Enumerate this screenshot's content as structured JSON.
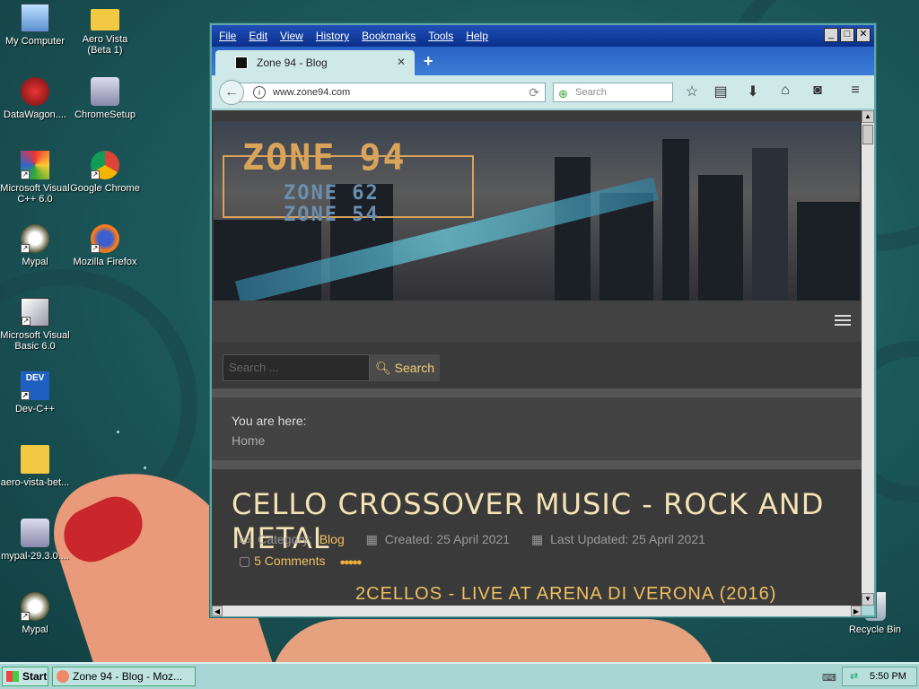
{
  "desktop": {
    "icons": [
      {
        "label": "My Computer"
      },
      {
        "label": "Aero Vista (Beta 1)"
      },
      {
        "label": "DataWagon...."
      },
      {
        "label": "ChromeSetup"
      },
      {
        "label": "Microsoft Visual C++ 6.0"
      },
      {
        "label": "Google Chrome"
      },
      {
        "label": "Mypal"
      },
      {
        "label": "Mozilla Firefox"
      },
      {
        "label": "Microsoft Visual Basic 6.0"
      },
      {
        "label": "Dev-C++"
      },
      {
        "label": "aero-vista-bet..."
      },
      {
        "label": "mypal-29.3.0...."
      },
      {
        "label": "Mypal"
      },
      {
        "label": "Recycle Bin"
      }
    ]
  },
  "browser": {
    "menu": [
      "File",
      "Edit",
      "View",
      "History",
      "Bookmarks",
      "Tools",
      "Help"
    ],
    "tab_title": "Zone 94 - Blog",
    "url": "www.zone94.com",
    "search_placeholder": "Search",
    "colors": {
      "accent": "#f0c060",
      "title": "#f4e3b4",
      "page_bg": "#3a3a3a"
    }
  },
  "page": {
    "logo": {
      "main": "ZONE 94",
      "sub1": "ZONE 62",
      "sub2": "ZONE 54"
    },
    "search": {
      "placeholder": "Search ...",
      "button": "Search"
    },
    "breadcrumb": {
      "label": "You are here:",
      "home": "Home"
    },
    "article": {
      "title": "CELLO CROSSOVER MUSIC - ROCK AND METAL",
      "category_label": "Category:",
      "category": "Blog",
      "created": "Created: 25 April 2021",
      "updated": "Last Updated: 25 April 2021",
      "comments": "5 Comments",
      "subtitle": "2CELLOS - LIVE AT ARENA DI VERONA (2016)"
    }
  },
  "taskbar": {
    "start": "Start",
    "task": "Zone 94 - Blog - Moz...",
    "time": "5:50 PM"
  }
}
